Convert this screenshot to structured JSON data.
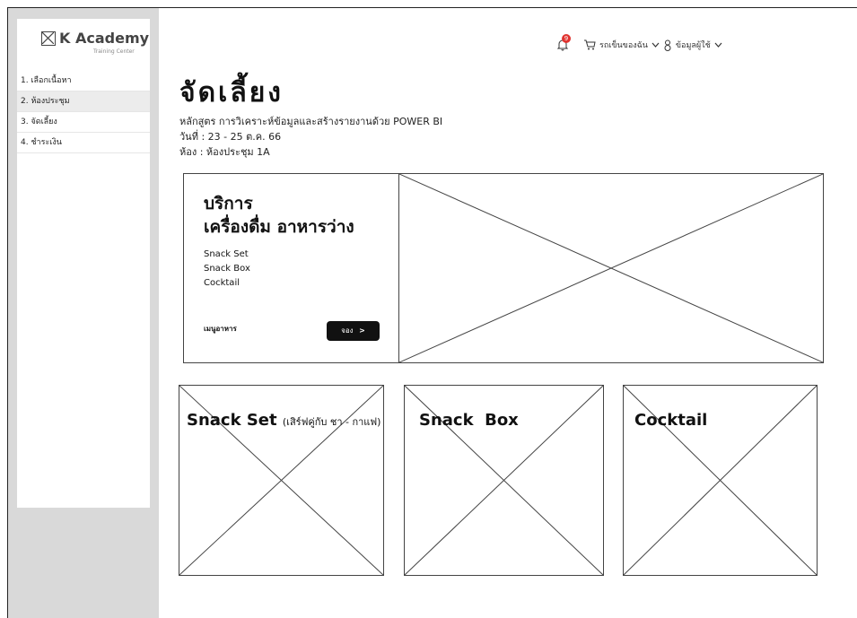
{
  "logo": {
    "title": "K Academy",
    "subtitle": "Training Center"
  },
  "sidebar": {
    "items": [
      {
        "label": "1. เลือกเนื้อหา"
      },
      {
        "label": "2. ห้องประชุม"
      },
      {
        "label": "3. จัดเลี้ยง"
      },
      {
        "label": "4. ชำระเงิน"
      }
    ]
  },
  "topbar": {
    "notification_count": "9",
    "cart_label": "รถเข็นของฉัน",
    "profile_label": "ข้อมูลผู้ใช้"
  },
  "page": {
    "title": "จัดเลี้ยง",
    "course_line": "หลักสูตร การวิเคราะห์ข้อมูลและสร้างรายงานด้วย POWER BI",
    "date_line": "วันที่ : 23 - 25 ต.ค. 66",
    "room_line": "ห้อง : ห้องประชุม 1A"
  },
  "hero": {
    "title_line1": "บริการ",
    "title_line2": "เครื่องดื่ม อาหารว่าง",
    "items": [
      "Snack Set",
      "Snack Box",
      "Cocktail"
    ],
    "menu_link": "เมนูอาหาร",
    "book_label": "จอง"
  },
  "cards": [
    {
      "title": "Snack Set",
      "subtitle": "(เสิร์ฟคู่กับ ชา - กาแฟ)"
    },
    {
      "title": "Snack  Box",
      "subtitle": ""
    },
    {
      "title": "Cocktail",
      "subtitle": ""
    }
  ]
}
